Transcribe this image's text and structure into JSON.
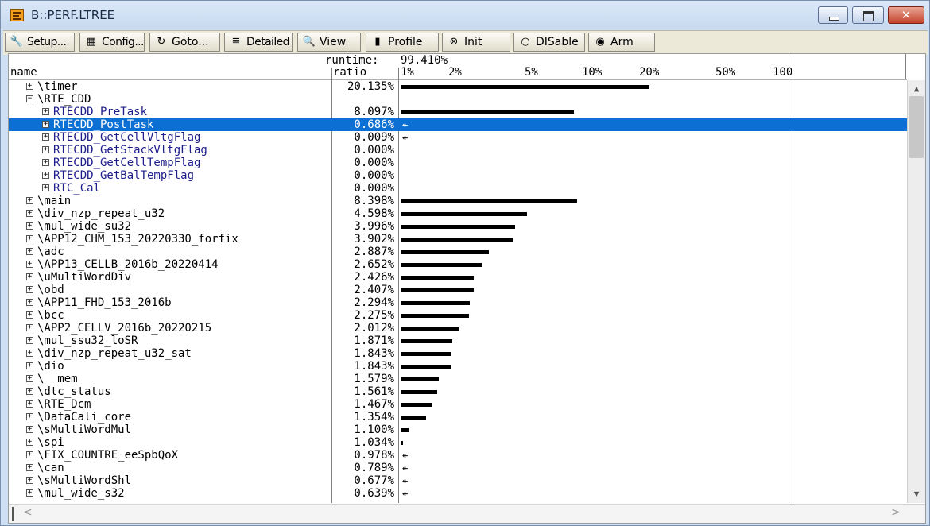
{
  "window": {
    "title": "B::PERF.LTREE",
    "close_glyph": "✕"
  },
  "toolbar": [
    {
      "label": "Setup...",
      "icon": "wrench-icon",
      "glyph": "🔧"
    },
    {
      "label": "Config...",
      "icon": "grid-icon",
      "glyph": "▦"
    },
    {
      "label": "Goto...",
      "icon": "goto-arrow-icon",
      "glyph": "↻"
    },
    {
      "label": "Detailed",
      "icon": "list-detail-icon",
      "glyph": "≣"
    },
    {
      "label": "View",
      "icon": "magnifier-icon",
      "glyph": "🔍"
    },
    {
      "label": "Profile",
      "icon": "profile-bars-icon",
      "glyph": "▮"
    },
    {
      "label": "Init",
      "icon": "init-circle-x-icon",
      "glyph": "⊗"
    },
    {
      "label": "DISable",
      "icon": "disable-circle-icon",
      "glyph": "○"
    },
    {
      "label": "Arm",
      "icon": "arm-radio-icon",
      "glyph": "◉"
    }
  ],
  "header": {
    "runtime_label": "runtime:",
    "runtime_value": "99.410%",
    "col_name": "name",
    "col_ratio": "ratio",
    "scale": [
      "1%",
      "2%",
      "5%",
      "10%",
      "20%",
      "50%",
      "100"
    ]
  },
  "rows": [
    {
      "name": "\\timer",
      "ratio": "20.135%",
      "value": 20.135,
      "level": 0,
      "expander": "+"
    },
    {
      "name": "\\RTE_CDD",
      "ratio": "",
      "value": null,
      "level": 0,
      "expander": "−"
    },
    {
      "name": "RTECDD_PreTask",
      "ratio": "8.097%",
      "value": 8.097,
      "level": 1,
      "expander": "+"
    },
    {
      "name": "RTECDD_PostTask",
      "ratio": "0.686%",
      "value": 0.686,
      "level": 1,
      "expander": "+",
      "selected": true
    },
    {
      "name": "RTECDD_GetCellVltgFlag",
      "ratio": "0.009%",
      "value": 0.009,
      "level": 1,
      "expander": "+"
    },
    {
      "name": "RTECDD_GetStackVltgFlag",
      "ratio": "0.000%",
      "value": 0.0,
      "level": 1,
      "expander": "+"
    },
    {
      "name": "RTECDD_GetCellTempFlag",
      "ratio": "0.000%",
      "value": 0.0,
      "level": 1,
      "expander": "+"
    },
    {
      "name": "RTECDD_GetBalTempFlag",
      "ratio": "0.000%",
      "value": 0.0,
      "level": 1,
      "expander": "+"
    },
    {
      "name": "RTC_Cal",
      "ratio": "0.000%",
      "value": 0.0,
      "level": 1,
      "expander": "+"
    },
    {
      "name": "\\main",
      "ratio": "8.398%",
      "value": 8.398,
      "level": 0,
      "expander": "+"
    },
    {
      "name": "\\div_nzp_repeat_u32",
      "ratio": "4.598%",
      "value": 4.598,
      "level": 0,
      "expander": "+"
    },
    {
      "name": "\\mul_wide_su32",
      "ratio": "3.996%",
      "value": 3.996,
      "level": 0,
      "expander": "+"
    },
    {
      "name": "\\APP12_CHM_153_20220330_forfix",
      "ratio": "3.902%",
      "value": 3.902,
      "level": 0,
      "expander": "+"
    },
    {
      "name": "\\adc",
      "ratio": "2.887%",
      "value": 2.887,
      "level": 0,
      "expander": "+"
    },
    {
      "name": "\\APP13_CELLB_2016b_20220414",
      "ratio": "2.652%",
      "value": 2.652,
      "level": 0,
      "expander": "+"
    },
    {
      "name": "\\uMultiWordDiv",
      "ratio": "2.426%",
      "value": 2.426,
      "level": 0,
      "expander": "+"
    },
    {
      "name": "\\obd",
      "ratio": "2.407%",
      "value": 2.407,
      "level": 0,
      "expander": "+"
    },
    {
      "name": "\\APP11_FHD_153_2016b",
      "ratio": "2.294%",
      "value": 2.294,
      "level": 0,
      "expander": "+"
    },
    {
      "name": "\\bcc",
      "ratio": "2.275%",
      "value": 2.275,
      "level": 0,
      "expander": "+"
    },
    {
      "name": "\\APP2_CELLV_2016b_20220215",
      "ratio": "2.012%",
      "value": 2.012,
      "level": 0,
      "expander": "+"
    },
    {
      "name": "\\mul_ssu32_loSR",
      "ratio": "1.871%",
      "value": 1.871,
      "level": 0,
      "expander": "+"
    },
    {
      "name": "\\div_nzp_repeat_u32_sat",
      "ratio": "1.843%",
      "value": 1.843,
      "level": 0,
      "expander": "+"
    },
    {
      "name": "\\dio",
      "ratio": "1.843%",
      "value": 1.843,
      "level": 0,
      "expander": "+"
    },
    {
      "name": "\\__mem",
      "ratio": "1.579%",
      "value": 1.579,
      "level": 0,
      "expander": "+"
    },
    {
      "name": "\\dtc_status",
      "ratio": "1.561%",
      "value": 1.561,
      "level": 0,
      "expander": "+"
    },
    {
      "name": "\\RTE_Dcm",
      "ratio": "1.467%",
      "value": 1.467,
      "level": 0,
      "expander": "+"
    },
    {
      "name": "\\DataCali_core",
      "ratio": "1.354%",
      "value": 1.354,
      "level": 0,
      "expander": "+"
    },
    {
      "name": "\\sMultiWordMul",
      "ratio": "1.100%",
      "value": 1.1,
      "level": 0,
      "expander": "+"
    },
    {
      "name": "\\spi",
      "ratio": "1.034%",
      "value": 1.034,
      "level": 0,
      "expander": "+"
    },
    {
      "name": "\\FIX_COUNTRE_eeSpbQoX",
      "ratio": "0.978%",
      "value": 0.978,
      "level": 0,
      "expander": "+"
    },
    {
      "name": "\\can",
      "ratio": "0.789%",
      "value": 0.789,
      "level": 0,
      "expander": "+"
    },
    {
      "name": "\\sMultiWordShl",
      "ratio": "0.677%",
      "value": 0.677,
      "level": 0,
      "expander": "+"
    },
    {
      "name": "\\mul_wide_s32",
      "ratio": "0.639%",
      "value": 0.639,
      "level": 0,
      "expander": "+"
    }
  ],
  "scrollbar": {
    "up": "▲",
    "down": "▼",
    "left": "<",
    "right": ">"
  },
  "below_scale_glyph": "↞"
}
